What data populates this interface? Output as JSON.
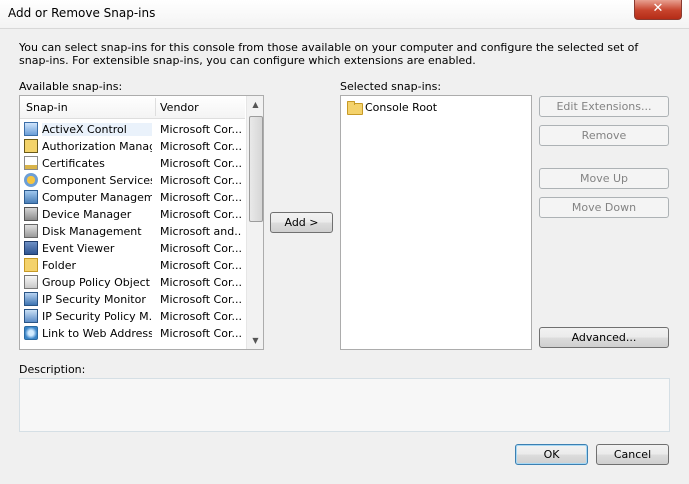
{
  "window": {
    "title": "Add or Remove Snap-ins",
    "close_glyph": "✕"
  },
  "intro_text": "You can select snap-ins for this console from those available on your computer and configure the selected set of snap-ins. For extensible snap-ins, you can configure which extensions are enabled.",
  "available": {
    "label": "Available snap-ins:",
    "columns": {
      "snapin": "Snap-in",
      "vendor": "Vendor"
    },
    "items": [
      {
        "name": "ActiveX Control",
        "vendor": "Microsoft Cor...",
        "icon": "activex-icon",
        "selected": true
      },
      {
        "name": "Authorization Manager",
        "vendor": "Microsoft Cor...",
        "icon": "authorization-icon"
      },
      {
        "name": "Certificates",
        "vendor": "Microsoft Cor...",
        "icon": "certificate-icon"
      },
      {
        "name": "Component Services",
        "vendor": "Microsoft Cor...",
        "icon": "component-services-icon"
      },
      {
        "name": "Computer Managem...",
        "vendor": "Microsoft Cor...",
        "icon": "computer-management-icon"
      },
      {
        "name": "Device Manager",
        "vendor": "Microsoft Cor...",
        "icon": "device-manager-icon"
      },
      {
        "name": "Disk Management",
        "vendor": "Microsoft and...",
        "icon": "disk-icon"
      },
      {
        "name": "Event Viewer",
        "vendor": "Microsoft Cor...",
        "icon": "event-viewer-icon"
      },
      {
        "name": "Folder",
        "vendor": "Microsoft Cor...",
        "icon": "folder-icon"
      },
      {
        "name": "Group Policy Object ...",
        "vendor": "Microsoft Cor...",
        "icon": "group-policy-icon"
      },
      {
        "name": "IP Security Monitor",
        "vendor": "Microsoft Cor...",
        "icon": "ip-security-icon"
      },
      {
        "name": "IP Security Policy M...",
        "vendor": "Microsoft Cor...",
        "icon": "ip-security-policy-icon"
      },
      {
        "name": "Link to Web Address",
        "vendor": "Microsoft Cor...",
        "icon": "web-link-icon"
      }
    ]
  },
  "add_button": "Add >",
  "selected": {
    "label": "Selected snap-ins:",
    "items": [
      {
        "name": "Console Root",
        "icon": "folder-icon"
      }
    ]
  },
  "side_buttons": {
    "edit_extensions": "Edit Extensions...",
    "remove": "Remove",
    "move_up": "Move Up",
    "move_down": "Move Down",
    "advanced": "Advanced..."
  },
  "description": {
    "label": "Description:",
    "text": ""
  },
  "footer": {
    "ok": "OK",
    "cancel": "Cancel"
  },
  "scrollbar": {
    "up_glyph": "▲",
    "down_glyph": "▼"
  }
}
